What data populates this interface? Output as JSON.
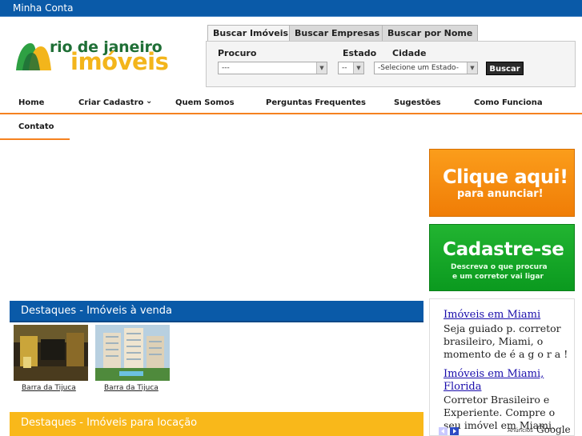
{
  "topbar": {
    "account_label": "Minha Conta"
  },
  "logo": {
    "line1": "rio de janeiro",
    "line2": "imóveis"
  },
  "search": {
    "tabs": [
      {
        "label": "Buscar Imóveis",
        "active": true
      },
      {
        "label": "Buscar Empresas",
        "active": false
      },
      {
        "label": "Buscar por Nome",
        "active": false
      }
    ],
    "labels": {
      "procuro": "Procuro",
      "estado": "Estado",
      "cidade": "Cidade"
    },
    "procuro_value": "---",
    "estado_value": "--",
    "cidade_value": "-Selecione um Estado-",
    "button_label": "Buscar"
  },
  "nav": {
    "items": [
      {
        "label": "Home"
      },
      {
        "label": "Criar Cadastro"
      },
      {
        "label": "Quem Somos"
      },
      {
        "label": "Perguntas Frequentes"
      },
      {
        "label": "Sugestões"
      },
      {
        "label": "Como Funciona"
      },
      {
        "label": "Contato"
      }
    ]
  },
  "banners": {
    "anunciar": {
      "line1": "Clique aqui!",
      "line2": "para anunciar!"
    },
    "cadastre": {
      "line1": "Cadastre-se",
      "line2": "Descreva o que procura",
      "line3": "e um corretor vai ligar"
    }
  },
  "destaques_venda": {
    "title": "Destaques - Imóveis à venda",
    "items": [
      {
        "caption": "Barra da Tijuca"
      },
      {
        "caption": "Barra da Tijuca"
      }
    ]
  },
  "destaques_locacao": {
    "title": "Destaques - Imóveis para locação"
  },
  "ads": {
    "items": [
      {
        "title": "Imóveis em Miami",
        "text": "Seja guiado p. corretor brasileiro, Miami, o momento de é a g o r a !"
      },
      {
        "title": "Imóveis em Miami, Florida",
        "text": "Corretor Brasileiro e Experiente. Compre o seu imóvel em Miami."
      }
    ],
    "footer_label": "Anúncios",
    "footer_brand": "Google"
  },
  "colors": {
    "brand_blue": "#0a5aa8",
    "accent_orange": "#f58220",
    "section_yellow": "#f9b81a",
    "banner_green": "#16a828"
  }
}
